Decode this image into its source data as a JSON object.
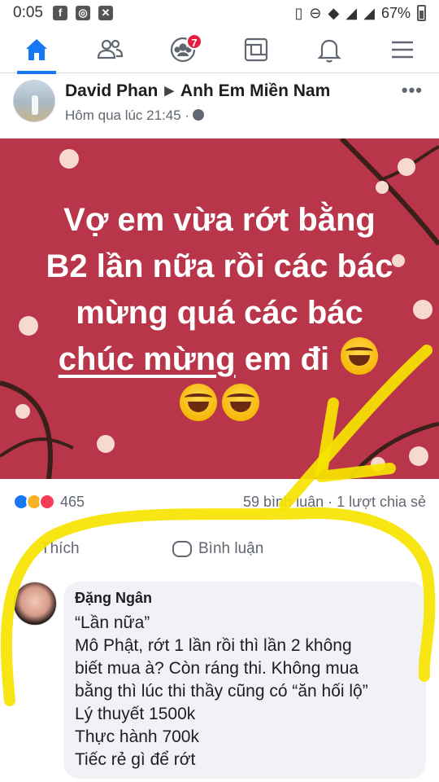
{
  "status_bar": {
    "time": "0:05",
    "battery": "67%"
  },
  "nav": {
    "items": [
      {
        "name": "home",
        "icon": "home-icon",
        "active": true
      },
      {
        "name": "friends",
        "icon": "friends-icon"
      },
      {
        "name": "groups",
        "icon": "groups-icon",
        "badge": "7"
      },
      {
        "name": "pages",
        "icon": "pages-icon"
      },
      {
        "name": "notifications",
        "icon": "bell-icon"
      },
      {
        "name": "menu",
        "icon": "hamburger-menu-icon"
      }
    ],
    "accent_color": "#1877f2",
    "badge_color": "#e41e3f"
  },
  "post": {
    "author": "David Phan",
    "group": "Anh Em Miền Nam",
    "timestamp": "Hôm qua lúc 21:45 ·",
    "more": "•••",
    "banner": {
      "background": "#b8354a",
      "line1": "Vợ em vừa rớt bằng",
      "line2": "B2 lần nữa rồi các bác",
      "line3": "mừng quá các bác",
      "line4_underlined": "chúc mừng",
      "line4_rest": " em đi"
    },
    "reactions_count": "465",
    "comments_shares": "59 bình luận · 1 lượt chia sẻ",
    "actions": {
      "like": "Thích",
      "comment": "Bình luận"
    }
  },
  "comment": {
    "author": "Đặng Ngân",
    "lines": [
      "“Lần nữa”",
      "Mô Phật, rớt 1 lần rồi thì lần 2 không",
      "biết mua à? Còn ráng thi. Không mua",
      "bằng thì lúc thi thầy cũng có “ăn hối lộ”",
      "Lý thuyết 1500k",
      "Thực hành 700k",
      "Tiếc rẻ gì để rớt"
    ]
  },
  "annotation_color": "#f7e400"
}
